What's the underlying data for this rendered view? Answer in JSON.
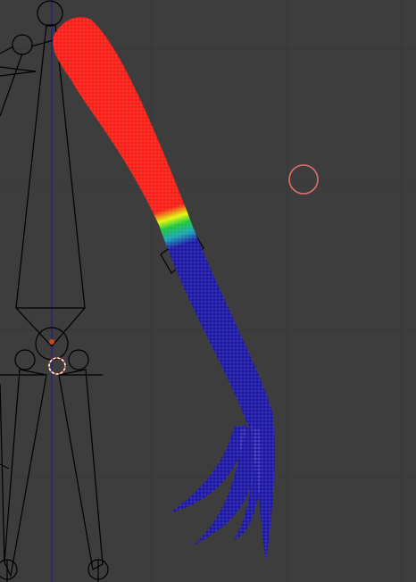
{
  "viewport": {
    "mode": "weight-paint",
    "background_color": "#3d3d3d",
    "grid_color": "#363636",
    "axis_color": "#1f1f8a"
  },
  "colors": {
    "armature_stroke": "#000000",
    "joint_highlight": "#cc4411",
    "weight_high": "#ff1a0a",
    "weight_mid_yellow": "#e8ff00",
    "weight_mid_green": "#18c830",
    "weight_mid_cyan": "#14a8b0",
    "weight_low": "#1a14a0",
    "wireframe": "#aeb4ff",
    "brush_cursor": "#e07070",
    "origin_red": "#e04020",
    "origin_white": "#ffffff"
  },
  "icons": {
    "brush_cursor": "circle-outline-icon",
    "object_origin": "origin-crosshair-icon",
    "joint": "bone-joint-icon"
  }
}
